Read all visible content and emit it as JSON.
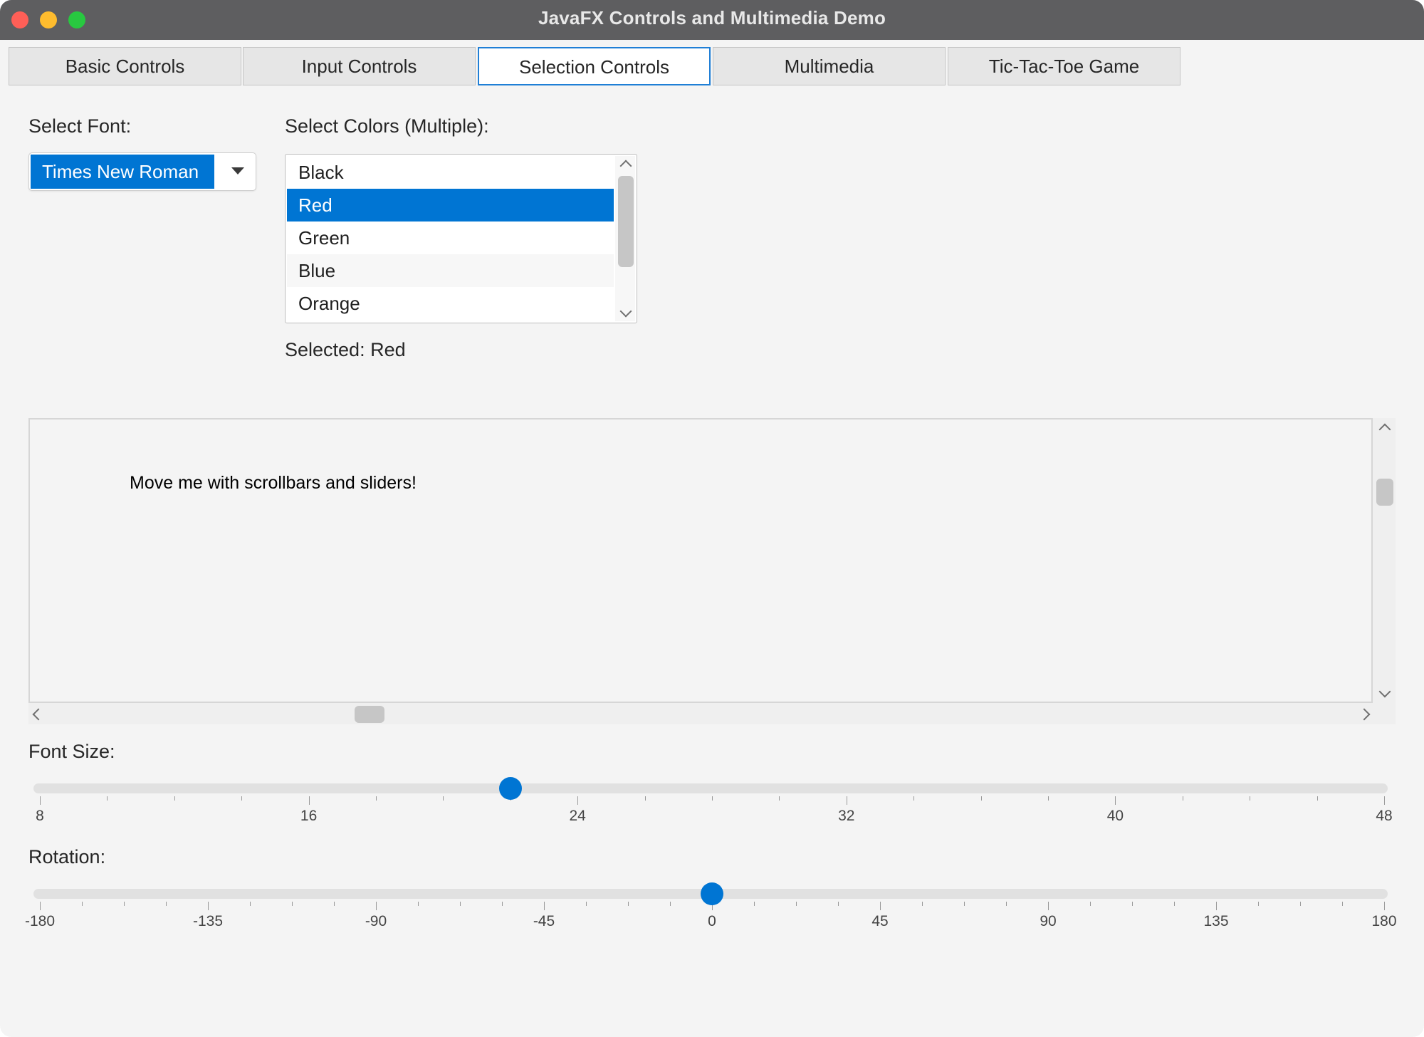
{
  "window": {
    "title": "JavaFX Controls and Multimedia Demo"
  },
  "tabs": [
    {
      "label": "Basic Controls",
      "selected": false
    },
    {
      "label": "Input Controls",
      "selected": false
    },
    {
      "label": "Selection Controls",
      "selected": true
    },
    {
      "label": "Multimedia",
      "selected": false
    },
    {
      "label": "Tic-Tac-Toe Game",
      "selected": false
    }
  ],
  "font_select": {
    "label": "Select Font:",
    "value": "Times New Roman"
  },
  "colors": {
    "label": "Select Colors (Multiple):",
    "items": [
      "Black",
      "Red",
      "Green",
      "Blue",
      "Orange"
    ],
    "selected_index": 1,
    "status": "Selected: Red"
  },
  "scroll_pane": {
    "text": "Move me with scrollbars and sliders!"
  },
  "font_size_slider": {
    "label": "Font Size:",
    "min": 8,
    "max": 48,
    "value": 22,
    "major_labels": [
      "8",
      "16",
      "24",
      "32",
      "40",
      "48"
    ]
  },
  "rotation_slider": {
    "label": "Rotation:",
    "min": -180,
    "max": 180,
    "value": 0,
    "major_labels": [
      "-180",
      "-135",
      "-90",
      "-45",
      "0",
      "45",
      "90",
      "135",
      "180"
    ]
  },
  "colors_ui": {
    "accent": "#0075d3"
  }
}
